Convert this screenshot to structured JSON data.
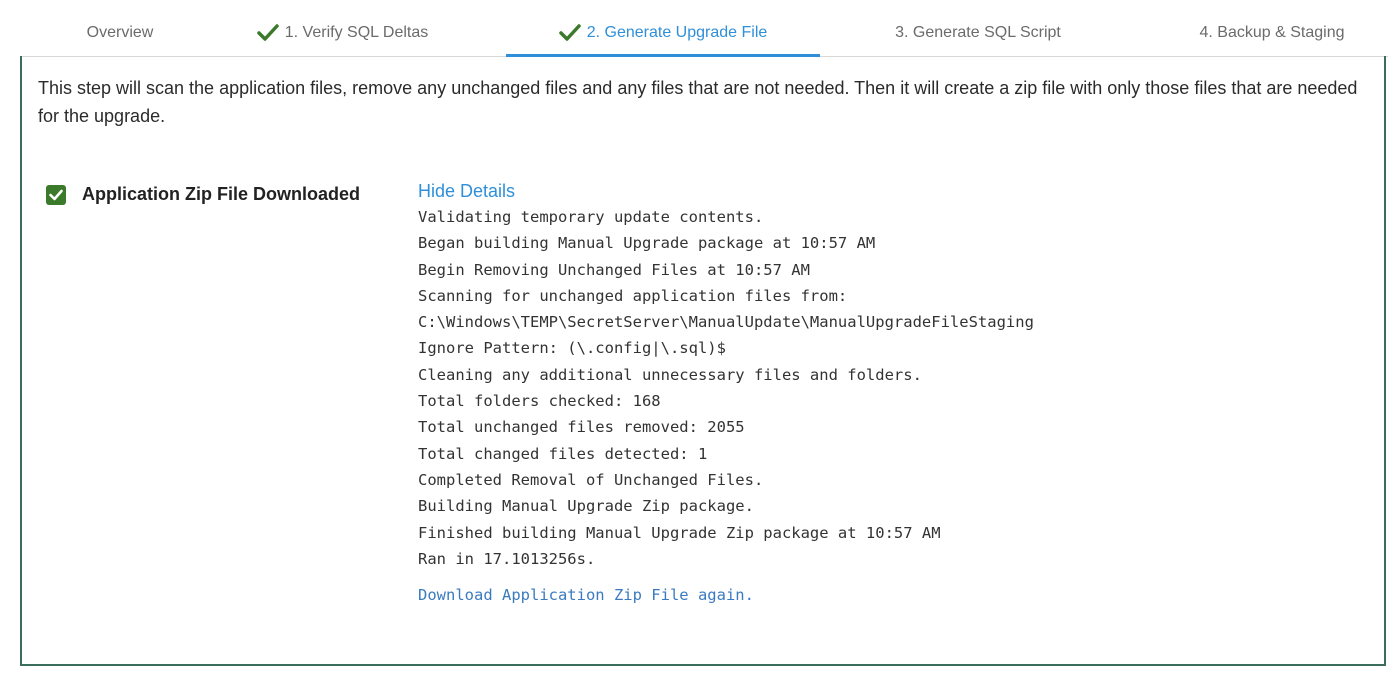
{
  "tabs": [
    {
      "label": "Overview",
      "checked": false,
      "active": false
    },
    {
      "label": "1. Verify SQL Deltas",
      "checked": true,
      "active": false
    },
    {
      "label": "2. Generate Upgrade File",
      "checked": true,
      "active": true
    },
    {
      "label": "3. Generate SQL Script",
      "checked": false,
      "active": false
    },
    {
      "label": "4. Backup & Staging",
      "checked": false,
      "active": false
    }
  ],
  "intro_text": "This step will scan the application files, remove any unchanged files and any files that are not needed. Then it will create a zip file with only those files that are needed for the upgrade.",
  "status": {
    "label": "Application Zip File Downloaded",
    "checked": true
  },
  "details": {
    "toggle_label": "Hide Details",
    "log_lines": [
      "Validating temporary update contents.",
      "Began building Manual Upgrade package at 10:57 AM",
      "Begin Removing Unchanged Files at 10:57 AM",
      "Scanning for unchanged application files from:",
      "C:\\Windows\\TEMP\\SecretServer\\ManualUpdate\\ManualUpgradeFileStaging",
      "Ignore Pattern: (\\.config|\\.sql)$",
      "Cleaning any additional unnecessary files and folders.",
      "Total folders checked: 168",
      "Total unchanged files removed: 2055",
      "Total changed files detected: 1",
      "Completed Removal of Unchanged Files.",
      "Building Manual Upgrade Zip package.",
      "Finished building Manual Upgrade Zip package at 10:57 AM",
      "Ran in 17.1013256s."
    ],
    "download_again_label": "Download Application Zip File again."
  },
  "colors": {
    "accent": "#2f8fd8",
    "check_green": "#3c7a2b",
    "panel_border": "#3a6e5a"
  },
  "icons": {
    "tab_check": "checkmark-icon",
    "status_check": "checkbox-checked-icon"
  }
}
